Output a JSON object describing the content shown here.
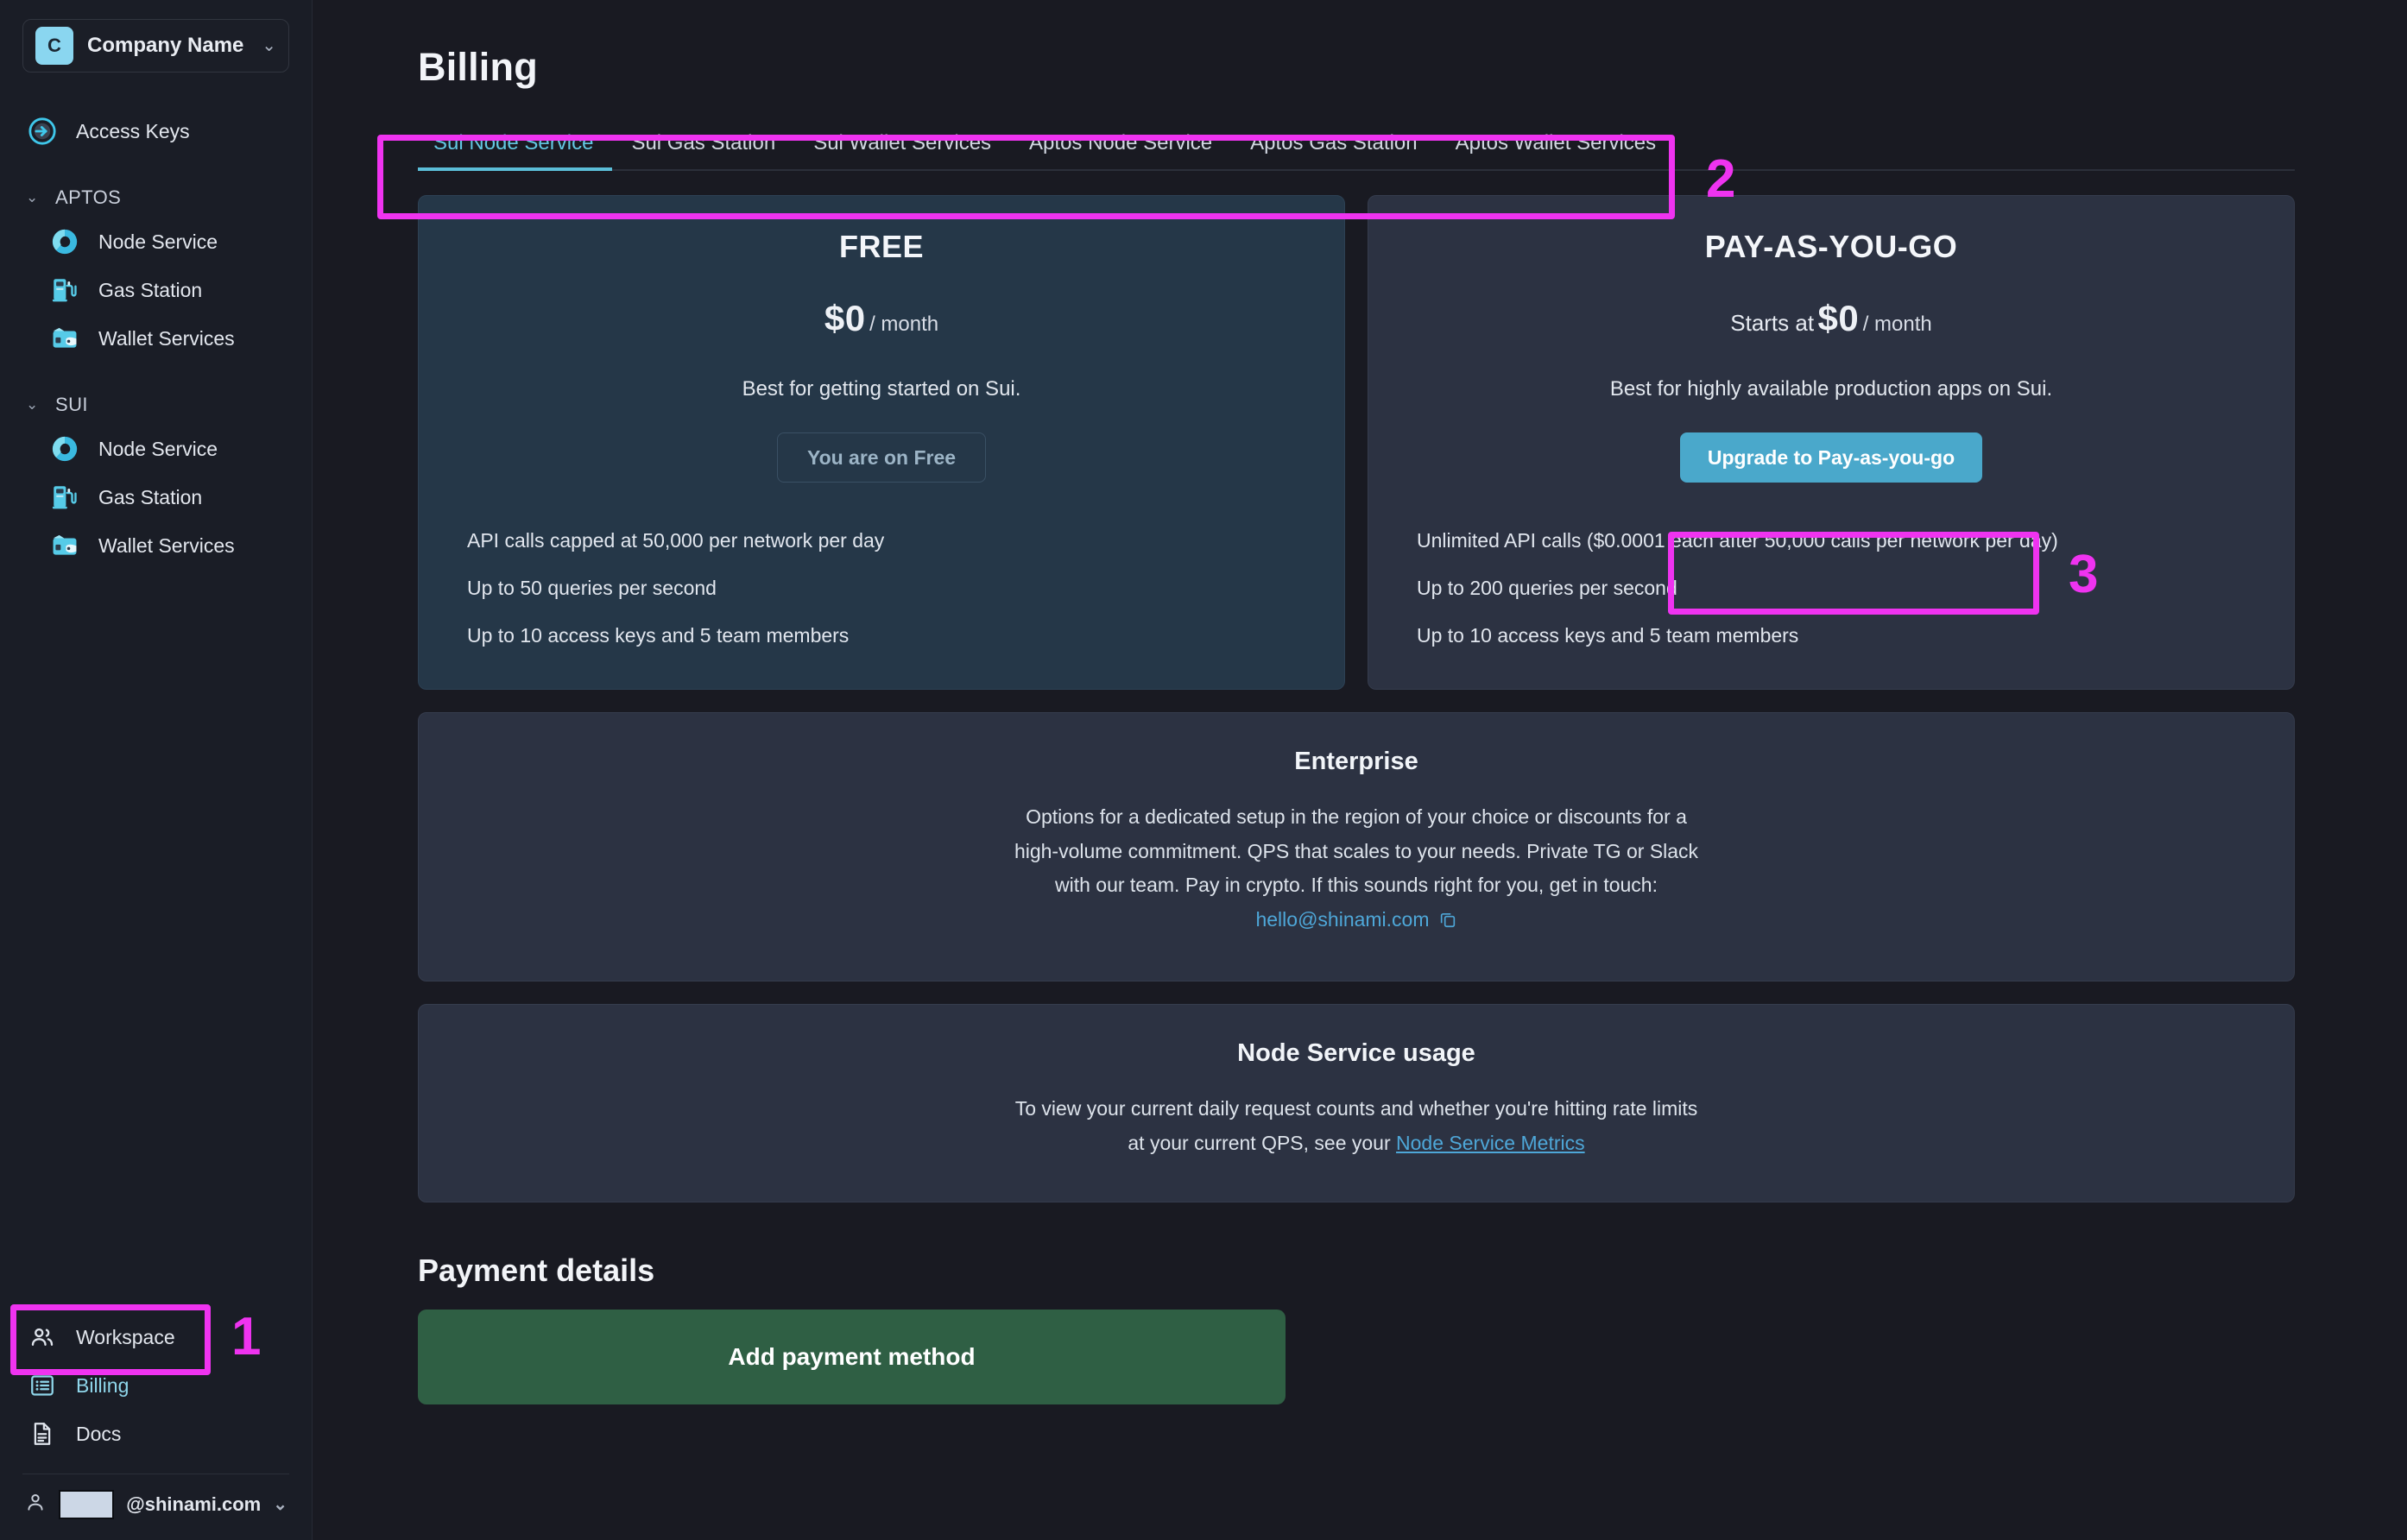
{
  "sidebar": {
    "org": {
      "badge_letter": "C",
      "name": "Company Name",
      "chevron": "⌄"
    },
    "primary": [
      {
        "label": "Access Keys",
        "icon": "access-key-icon"
      }
    ],
    "groups": [
      {
        "label": "APTOS",
        "chevron": "⌄",
        "items": [
          {
            "label": "Node Service",
            "icon": "node-service-icon"
          },
          {
            "label": "Gas Station",
            "icon": "gas-station-icon"
          },
          {
            "label": "Wallet Services",
            "icon": "wallet-services-icon"
          }
        ]
      },
      {
        "label": "SUI",
        "chevron": "⌄",
        "items": [
          {
            "label": "Node Service",
            "icon": "node-service-icon"
          },
          {
            "label": "Gas Station",
            "icon": "gas-station-icon"
          },
          {
            "label": "Wallet Services",
            "icon": "wallet-services-icon"
          }
        ]
      }
    ],
    "footer": [
      {
        "label": "Workspace",
        "icon": "people-icon",
        "active": false
      },
      {
        "label": "Billing",
        "icon": "billing-list-icon",
        "active": true
      },
      {
        "label": "Docs",
        "icon": "document-icon",
        "active": false
      }
    ],
    "account": {
      "email_suffix": "@shinami.com",
      "chevron": "⌄"
    }
  },
  "header": {
    "title": "Billing"
  },
  "tabs": {
    "items": [
      {
        "label": "Sui Node Service",
        "active": true
      },
      {
        "label": "Sui Gas Station",
        "active": false
      },
      {
        "label": "Sui Wallet Services",
        "active": false
      },
      {
        "label": "Aptos Node Service",
        "active": false
      },
      {
        "label": "Aptos Gas Station",
        "active": false
      },
      {
        "label": "Aptos Wallet Services",
        "active": false
      }
    ]
  },
  "plans": {
    "free": {
      "name": "FREE",
      "price_prefix": "",
      "price_amount": "$0",
      "price_per": "/ month",
      "description": "Best for getting started on Sui.",
      "cta_label": "You are on Free",
      "features": [
        "API calls capped at 50,000 per network per day",
        "Up to 50 queries per second",
        "Up to 10 access keys and 5 team members"
      ]
    },
    "payg": {
      "name": "PAY-AS-YOU-GO",
      "price_prefix": "Starts at",
      "price_amount": "$0",
      "price_per": "/ month",
      "description": "Best for highly available production apps on Sui.",
      "cta_label": "Upgrade to Pay-as-you-go",
      "features": [
        "Unlimited API calls ($0.0001 each after 50,000 calls per network per day)",
        "Up to 200 queries per second",
        "Up to 10 access keys and 5 team members"
      ]
    }
  },
  "enterprise": {
    "title": "Enterprise",
    "body_line_1": "Options for a dedicated setup in the region of your choice or discounts for a",
    "body_line_2": "high-volume commitment. QPS that scales to your needs. Private TG or Slack",
    "body_line_3": "with our team. Pay in crypto. If this sounds right for you, get in touch:",
    "email": "hello@shinami.com"
  },
  "usage": {
    "title": "Node Service usage",
    "body_line_1": "To view your current daily request counts and whether you're hitting rate limits",
    "body_line_2_prefix": "at your current QPS, see your ",
    "link_label": "Node Service Metrics"
  },
  "payment": {
    "section_title": "Payment details",
    "add_button_label": "Add payment method"
  },
  "annotations": {
    "accent_color": "#ef33f0",
    "markers": [
      {
        "number": "1",
        "target": "sidebar-item-billing"
      },
      {
        "number": "2",
        "target": "billing-tabs"
      },
      {
        "number": "3",
        "target": "upgrade-to-payg-button"
      }
    ]
  }
}
